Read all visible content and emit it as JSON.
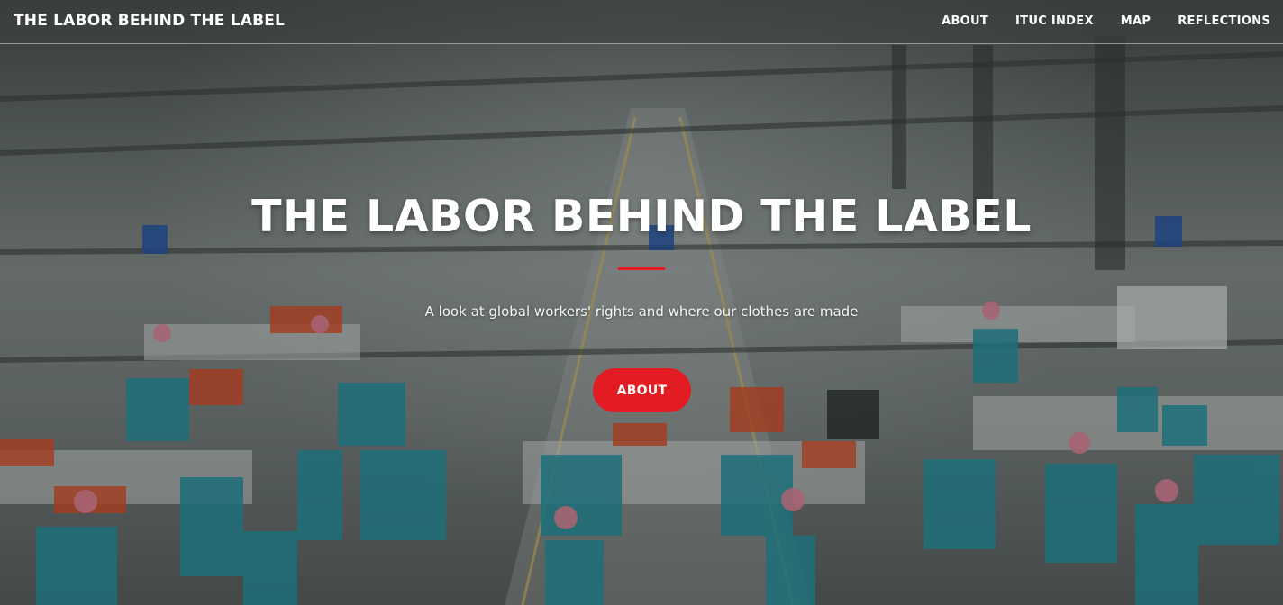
{
  "navbar": {
    "brand": "THE LABOR BEHIND THE LABEL",
    "links": [
      "ABOUT",
      "ITUC INDEX",
      "MAP",
      "REFLECTIONS"
    ]
  },
  "hero": {
    "title": "THE LABOR BEHIND THE LABEL",
    "subtitle": "A look at global workers' rights and where our clothes are made",
    "button_label": "ABOUT",
    "background": "photo of a garment factory floor with workers at sewing lines"
  },
  "colors": {
    "accent": "#e31b23",
    "text": "#ffffff"
  }
}
